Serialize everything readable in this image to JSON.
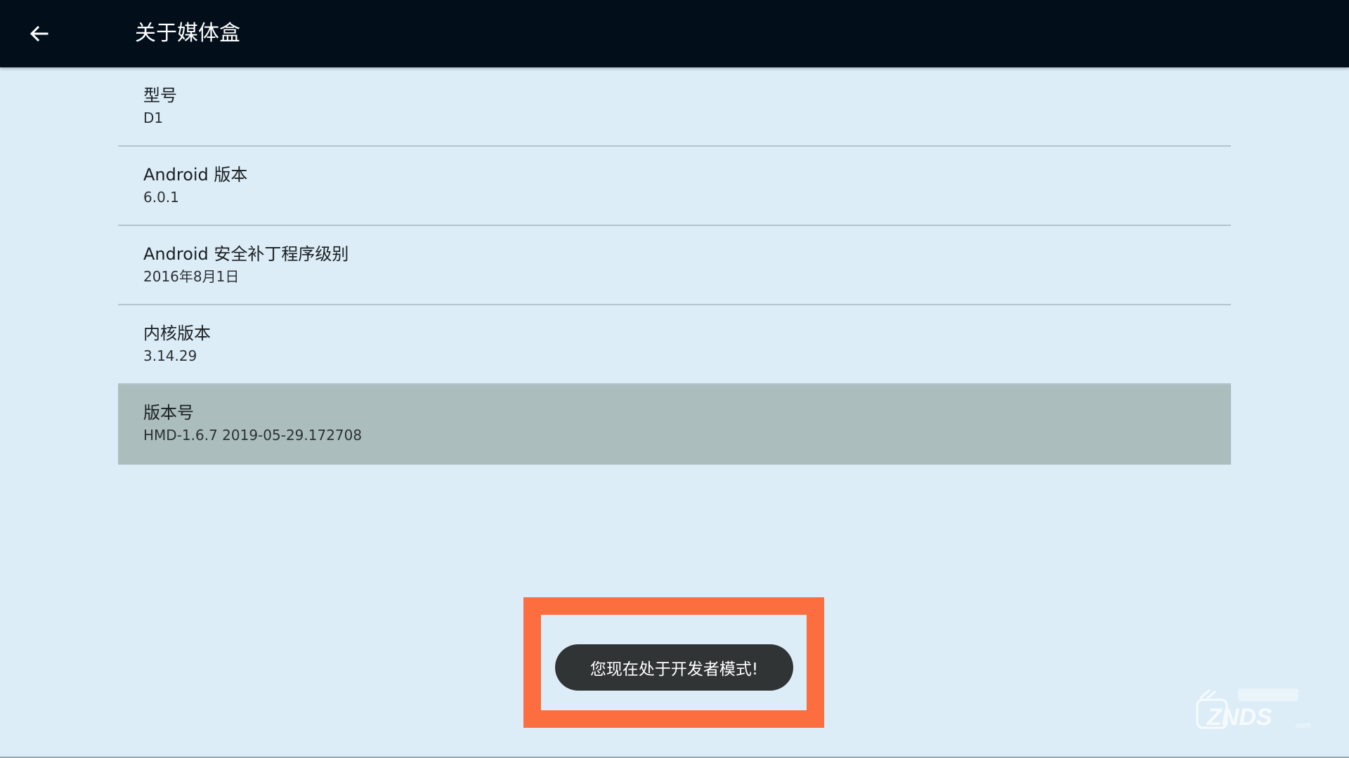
{
  "header": {
    "title": "关于媒体盒",
    "back_icon": "arrow-left-icon"
  },
  "items": [
    {
      "title": "型号",
      "value": "D1"
    },
    {
      "title": "Android 版本",
      "value": "6.0.1"
    },
    {
      "title": "Android 安全补丁程序级别",
      "value": "2016年8月1日"
    },
    {
      "title": "内核版本",
      "value": "3.14.29"
    },
    {
      "title": "版本号",
      "value": "HMD-1.6.7 2019-05-29.172708"
    }
  ],
  "focused_item_index": 4,
  "toast": {
    "message": "您现在处于开发者模式!"
  },
  "colors": {
    "header_bg": "#020f1b",
    "page_bg": "#dcedf8",
    "focused_row_bg": "#abbdbd",
    "toast_bg": "#303435",
    "highlight_border": "#fc6e3f"
  }
}
